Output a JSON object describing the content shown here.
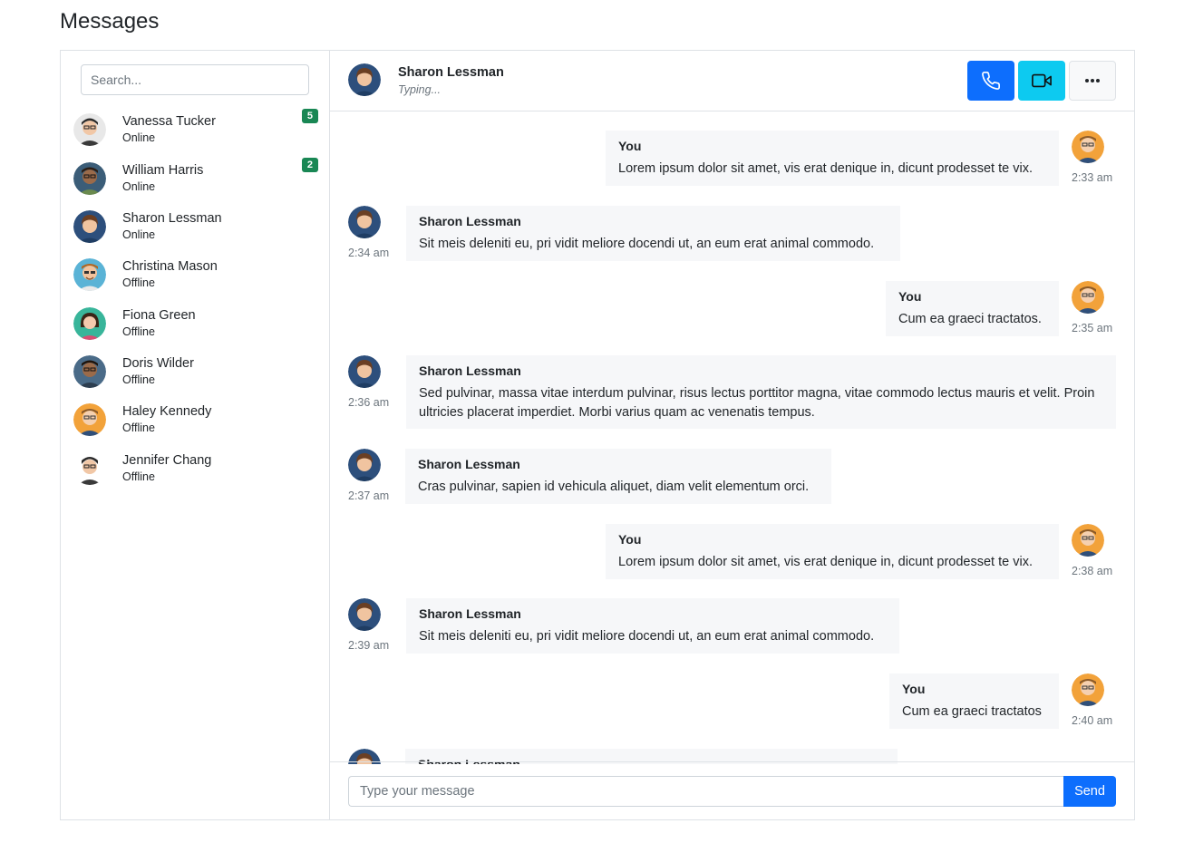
{
  "page": {
    "title": "Messages"
  },
  "sidebar": {
    "search_placeholder": "Search...",
    "contacts": [
      {
        "name": "Vanessa Tucker",
        "status": "Online",
        "badge": "5"
      },
      {
        "name": "William Harris",
        "status": "Online",
        "badge": "2"
      },
      {
        "name": "Sharon Lessman",
        "status": "Online"
      },
      {
        "name": "Christina Mason",
        "status": "Offline"
      },
      {
        "name": "Fiona Green",
        "status": "Offline"
      },
      {
        "name": "Doris Wilder",
        "status": "Offline"
      },
      {
        "name": "Haley Kennedy",
        "status": "Offline"
      },
      {
        "name": "Jennifer Chang",
        "status": "Offline"
      }
    ]
  },
  "chat": {
    "header": {
      "name": "Sharon Lessman",
      "status": "Typing..."
    },
    "actions": {
      "call_icon": "phone-icon",
      "video_icon": "video-camera-icon",
      "more_icon": "more-horizontal-icon"
    },
    "messages": [
      {
        "sender": "You",
        "text": "Lorem ipsum dolor sit amet, vis erat denique in, dicunt prodesset te vix.",
        "time": "2:33 am"
      },
      {
        "sender": "Sharon Lessman",
        "text": "Sit meis deleniti eu, pri vidit meliore docendi ut, an eum erat animal commodo.",
        "time": "2:34 am"
      },
      {
        "sender": "You",
        "text": "Cum ea graeci tractatos.",
        "time": "2:35 am"
      },
      {
        "sender": "Sharon Lessman",
        "text": "Sed pulvinar, massa vitae interdum pulvinar, risus lectus porttitor magna, vitae commodo lectus mauris et velit. Proin ultricies placerat imperdiet. Morbi varius quam ac venenatis tempus.",
        "time": "2:36 am"
      },
      {
        "sender": "Sharon Lessman",
        "text": "Cras pulvinar, sapien id vehicula aliquet, diam velit elementum orci.",
        "time": "2:37 am"
      },
      {
        "sender": "You",
        "text": "Lorem ipsum dolor sit amet, vis erat denique in, dicunt prodesset te vix.",
        "time": "2:38 am"
      },
      {
        "sender": "Sharon Lessman",
        "text": "Sit meis deleniti eu, pri vidit meliore docendi ut, an eum erat animal commodo.",
        "time": "2:39 am"
      },
      {
        "sender": "You",
        "text": "Cum ea graeci tractatos",
        "time": "2:40 am"
      },
      {
        "sender": "Sharon Lessman",
        "text": "",
        "time": ""
      }
    ]
  },
  "composer": {
    "placeholder": "Type your message",
    "send_label": "Send"
  },
  "colors": {
    "primary": "#0d6efd",
    "info": "#0dcaf0",
    "success": "#198754",
    "bubble": "#f6f7f9",
    "border": "#dee2e6"
  }
}
